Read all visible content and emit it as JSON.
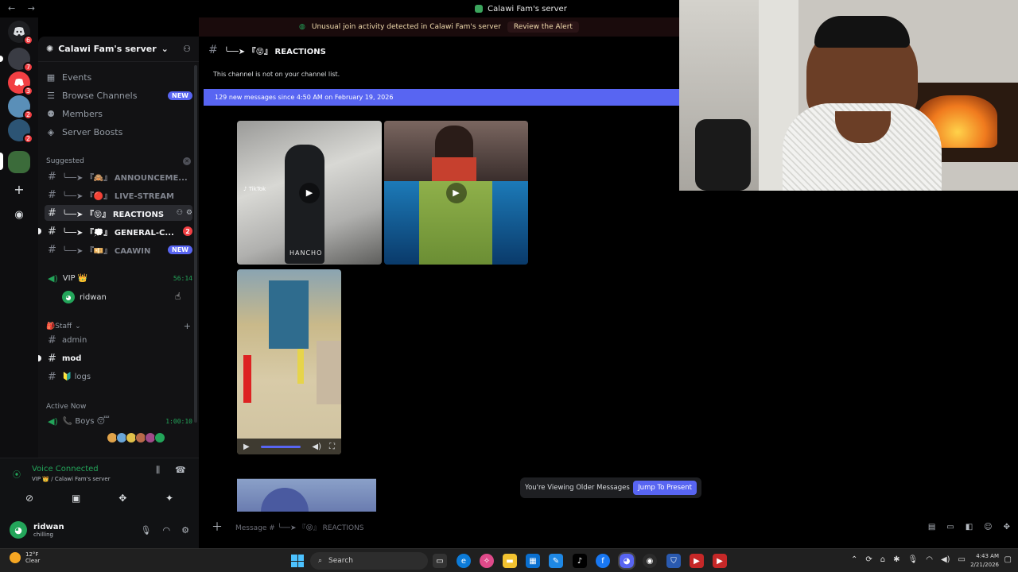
{
  "window": {
    "title": "Calawi Fam's server"
  },
  "alert": {
    "text": "Unusual join activity detected in Calawi Fam's server",
    "action": "Review the Alert"
  },
  "rail": {
    "servers": [
      {
        "name": "home",
        "badge": "6"
      },
      {
        "name": "server-2",
        "badge": "7"
      },
      {
        "name": "server-3",
        "badge": "3"
      },
      {
        "name": "server-4",
        "badge": "2"
      },
      {
        "name": "server-5",
        "badge": "2"
      },
      {
        "name": "calawi-fam",
        "badge": ""
      }
    ]
  },
  "sidebar": {
    "server_name": "Calawi Fam's server",
    "nav": [
      {
        "label": "Events",
        "icon": "calendar-icon"
      },
      {
        "label": "Browse Channels",
        "icon": "browse-icon",
        "badge": "NEW"
      },
      {
        "label": "Members",
        "icon": "members-icon"
      },
      {
        "label": "Server Boosts",
        "icon": "boost-icon"
      }
    ],
    "suggested_label": "Suggested",
    "channels": [
      {
        "name": "╰──➤ 『🙈』 ANNOUNCEME..."
      },
      {
        "name": "╰──➤ 『🔴』 LIVE-STREAM"
      },
      {
        "name": "╰──➤ 『😝』 REACTIONS"
      },
      {
        "name": "╰──➤ 『💭』 GENERAL-C...",
        "badge": "2"
      },
      {
        "name": "╰──➤ 『💴』 CAAWIN",
        "badge": "NEW"
      }
    ],
    "vip": {
      "name": "VIP 👑",
      "timer": "56:14",
      "member": "ridwan"
    },
    "staff": {
      "label": "🎒Staff",
      "channels": [
        "admin",
        "mod",
        "🔰 logs"
      ]
    },
    "active_now": {
      "label": "Active Now",
      "channel": "📞 Boys 😴",
      "timer": "1:00:10"
    }
  },
  "voice_panel": {
    "status": "Voice Connected",
    "location": "VIP 👑 / Calawi Fam's server"
  },
  "user_panel": {
    "name": "ridwan",
    "status": "chilling"
  },
  "main": {
    "channel_title": "╰──➤ 『😝』 REACTIONS",
    "not_on_list": "This channel is not on your channel list.",
    "new_messages": "129 new messages since 4:50 AM on February 19, 2026",
    "media": [
      {
        "caption": "HANCHO"
      }
    ],
    "older_text": "You're Viewing Older Messages",
    "jump_label": "Jump To Present",
    "composer_placeholder": "Message # ╰──➤ 『😝』 REACTIONS"
  },
  "taskbar": {
    "weather_temp": "12°F",
    "weather_desc": "Clear",
    "search_label": "Search",
    "time": "4:43 AM",
    "date": "2/21/2026"
  },
  "colors": {
    "blurple": "#5865f2",
    "green": "#23a55a",
    "red": "#f23f43",
    "sidebar": "#121214"
  }
}
